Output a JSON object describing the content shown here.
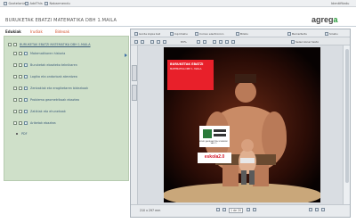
{
  "topbar": {
    "items": [
      "Gaztelania",
      "AddThis",
      "Nabarmendu"
    ],
    "right": "Identifikatu"
  },
  "header": {
    "title": "BURUKETAK EBATZI MATEMATIKA DBH 1.MAILA",
    "logo_main": "agreg",
    "logo_accent": "a"
  },
  "tabs": [
    {
      "label": "Edukiak",
      "active": true
    },
    {
      "label": "Irudiak",
      "active": false
    },
    {
      "label": "Bideoak",
      "active": false
    }
  ],
  "tree": {
    "main": "BURUKETAK EBATZI MATEMATIKA DBH 1.MAILA",
    "items": [
      "Matematikaren historia",
      "Buruketak ebazteko teknikaren",
      "Logika eta ondorioak ateratzea",
      "Zenbakiak eta eragiketaren bidezkoak",
      "Problema geometrikoak ebaztea",
      "Zatikiak eta ehunekoak",
      "Ariketak ebaztea"
    ],
    "pdf_label": "PDF"
  },
  "viewer": {
    "toolbar1": [
      "Gorde kopia bat",
      "Inprimatu",
      "Correo electronico",
      "Bilatu",
      "Berraztertu",
      "Sinatu"
    ],
    "toolbar2": [
      "Seleccionar texto",
      "83%"
    ],
    "side_tabs": [
      "Orriak",
      "Markak"
    ],
    "page_label": "1 de 20",
    "page_size": "210 x 297 mm",
    "document": {
      "red_title": "BURUKETAK EBATZI",
      "red_sub": "MATEMATIKA DBH 1. MAILA",
      "sponsor_logo": "EUSKO JAURLARITZA GOBIERNO VASCO",
      "brand": "eskola2.0"
    }
  }
}
